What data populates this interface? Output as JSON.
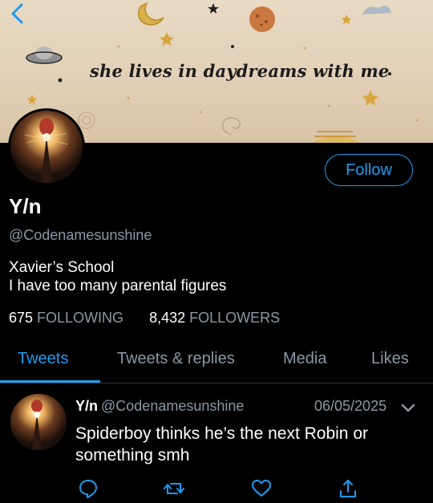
{
  "header": {
    "caption": "she lives in daydreams with me",
    "back_icon": "chevron-left-icon",
    "accent": "#1d9bf0"
  },
  "profile": {
    "name": "Y/n",
    "handle": "@Codenamesunshine",
    "follow_label": "Follow",
    "bio_lines": [
      "Xavier’s School",
      "I have too many parental figures"
    ],
    "following_count": "675",
    "following_label": "FOLLOWING",
    "followers_count": "8,432",
    "followers_label": "FOLLOWERS"
  },
  "tabs": [
    {
      "label": "Tweets",
      "active": true
    },
    {
      "label": "Tweets & replies",
      "active": false
    },
    {
      "label": "Media",
      "active": false
    },
    {
      "label": "Likes",
      "active": false
    }
  ],
  "tweet": {
    "name": "Y/n",
    "handle": "@Codenamesunshine",
    "date": "06/05/2025",
    "text": "Spiderboy thinks he’s the next Robin or something smh",
    "actions": [
      "reply-icon",
      "retweet-icon",
      "like-icon",
      "share-icon"
    ]
  },
  "colors": {
    "background": "#000000",
    "text": "#ffffff",
    "secondary_text": "#8b98a5",
    "accent": "#1d9bf0",
    "header_paper": "#e6d6bd"
  }
}
